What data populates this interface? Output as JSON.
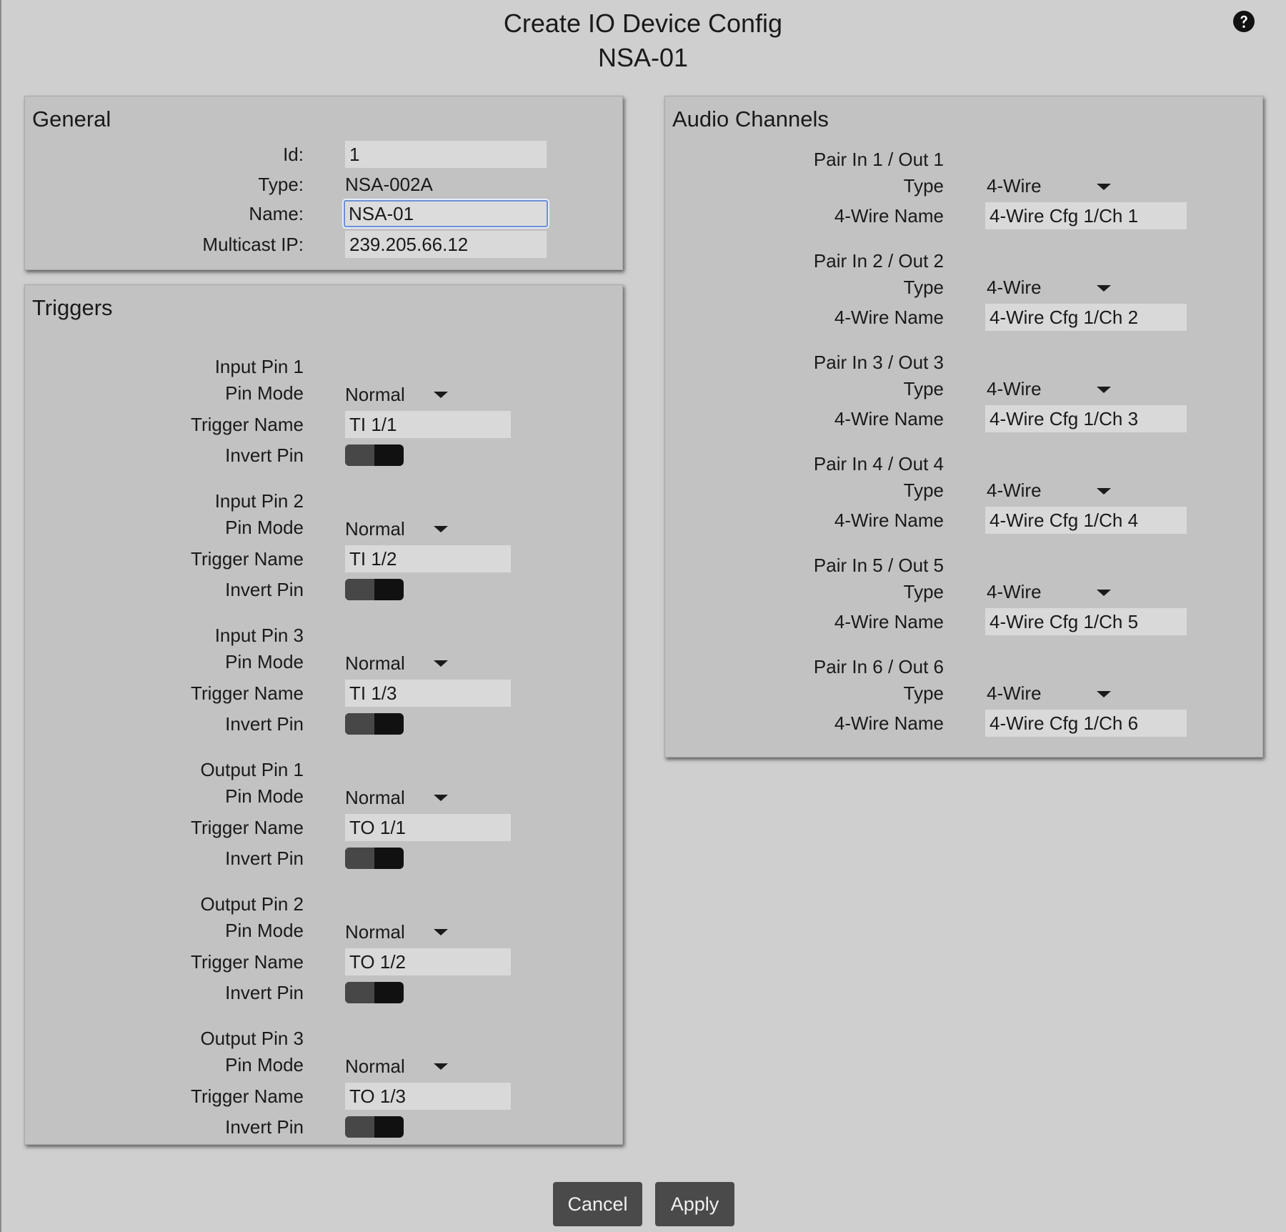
{
  "dialog": {
    "title": "Create IO Device Config",
    "subtitle": "NSA-01"
  },
  "general": {
    "title": "General",
    "id_label": "Id:",
    "id_value": "1",
    "type_label": "Type:",
    "type_value": "NSA-002A",
    "name_label": "Name:",
    "name_value": "NSA-01",
    "multicast_label": "Multicast IP:",
    "multicast_value": "239.205.66.12"
  },
  "triggers": {
    "title": "Triggers",
    "pin_mode_label": "Pin Mode",
    "trigger_name_label": "Trigger Name",
    "invert_pin_label": "Invert Pin",
    "pins": [
      {
        "label": "Input Pin 1",
        "mode": "Normal",
        "name": "TI 1/1",
        "invert": false
      },
      {
        "label": "Input Pin 2",
        "mode": "Normal",
        "name": "TI 1/2",
        "invert": false
      },
      {
        "label": "Input Pin 3",
        "mode": "Normal",
        "name": "TI 1/3",
        "invert": false
      },
      {
        "label": "Output Pin 1",
        "mode": "Normal",
        "name": "TO 1/1",
        "invert": false
      },
      {
        "label": "Output Pin 2",
        "mode": "Normal",
        "name": "TO 1/2",
        "invert": false
      },
      {
        "label": "Output Pin 3",
        "mode": "Normal",
        "name": "TO 1/3",
        "invert": false
      }
    ]
  },
  "audio": {
    "title": "Audio Channels",
    "type_label": "Type",
    "name_label": "4-Wire Name",
    "pairs": [
      {
        "label": "Pair In 1 / Out 1",
        "type": "4-Wire",
        "name": "4-Wire Cfg 1/Ch 1"
      },
      {
        "label": "Pair In 2 / Out 2",
        "type": "4-Wire",
        "name": "4-Wire Cfg 1/Ch 2"
      },
      {
        "label": "Pair In 3 / Out 3",
        "type": "4-Wire",
        "name": "4-Wire Cfg 1/Ch 3"
      },
      {
        "label": "Pair In 4 / Out 4",
        "type": "4-Wire",
        "name": "4-Wire Cfg 1/Ch 4"
      },
      {
        "label": "Pair In 5 / Out 5",
        "type": "4-Wire",
        "name": "4-Wire Cfg 1/Ch 5"
      },
      {
        "label": "Pair In 6 / Out 6",
        "type": "4-Wire",
        "name": "4-Wire Cfg 1/Ch 6"
      }
    ]
  },
  "footer": {
    "cancel_label": "Cancel",
    "apply_label": "Apply"
  }
}
